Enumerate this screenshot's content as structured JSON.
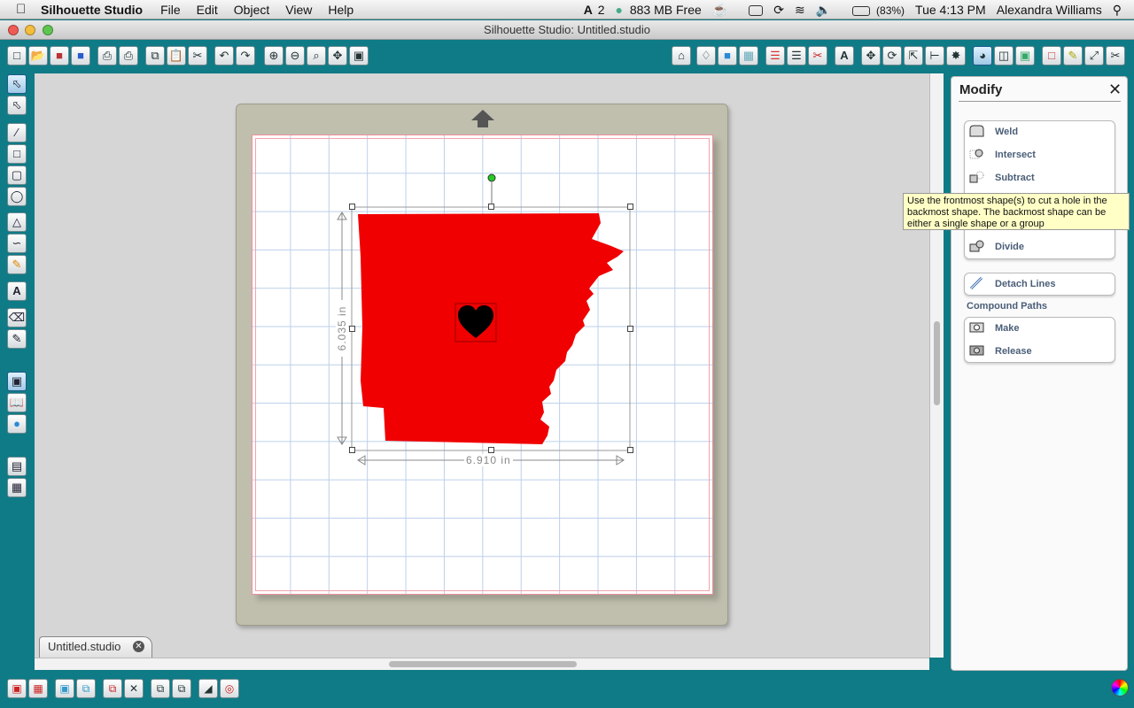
{
  "menubar": {
    "app_name": "Silhouette Studio",
    "menus": [
      "File",
      "Edit",
      "Object",
      "View",
      "Help"
    ],
    "status": {
      "adobe_count": "2",
      "memory": "883 MB Free",
      "battery": "(83%)",
      "clock": "Tue 4:13 PM",
      "user": "Alexandra Williams"
    }
  },
  "window": {
    "title": "Silhouette Studio: Untitled.studio"
  },
  "canvas": {
    "height_label": "6.035 in",
    "width_label": "6.910 in",
    "colors": {
      "shape_fill": "#f00000",
      "heart_fill": "#000000",
      "mat": "#c0bfae",
      "rotate_handle": "#22cc22"
    }
  },
  "tabs": [
    {
      "label": "Untitled.studio"
    }
  ],
  "panel": {
    "title": "Modify",
    "items": {
      "weld": "Weld",
      "intersect": "Intersect",
      "subtract": "Subtract",
      "divide": "Divide",
      "detach": "Detach Lines"
    },
    "compound_title": "Compound Paths",
    "compound": {
      "make": "Make",
      "release": "Release"
    }
  },
  "tooltip": {
    "line1": "Use the frontmost shape(s) to cut a hole in the",
    "line2": "backmost shape. The backmost shape can be",
    "line3": "either a single shape or a group"
  }
}
